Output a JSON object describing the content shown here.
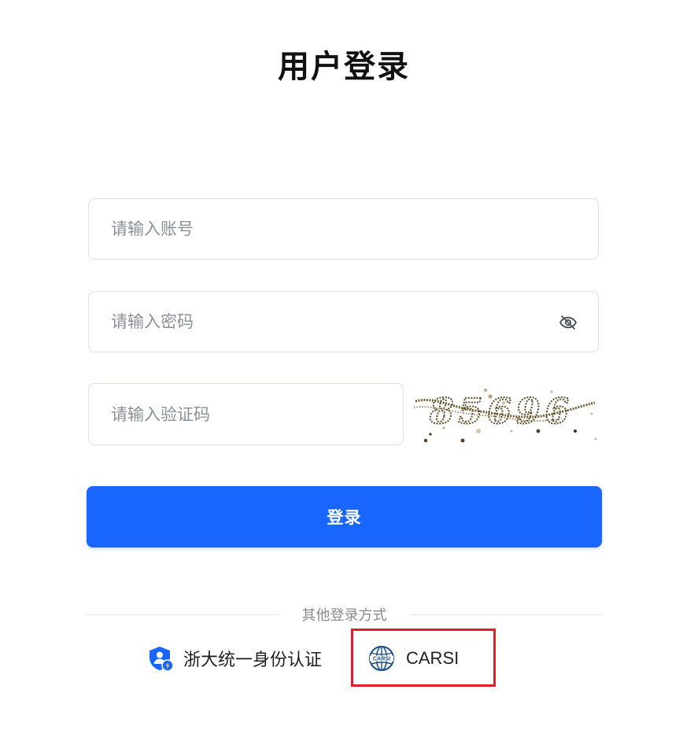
{
  "title": "用户登录",
  "form": {
    "account_placeholder": "请输入账号",
    "password_placeholder": "请输入密码",
    "captcha_placeholder": "请输入验证码",
    "captcha_text": "85696",
    "login_label": "登录"
  },
  "other_login": {
    "divider_text": "其他登录方式",
    "options": [
      {
        "label": "浙大统一身份认证",
        "icon": "shield-user-icon"
      },
      {
        "label": "CARSI",
        "icon": "carsi-globe-icon"
      }
    ]
  },
  "colors": {
    "primary": "#1966ff",
    "highlight": "#e0202c",
    "border": "#dcdfe6",
    "placeholder": "#8b8f96"
  }
}
